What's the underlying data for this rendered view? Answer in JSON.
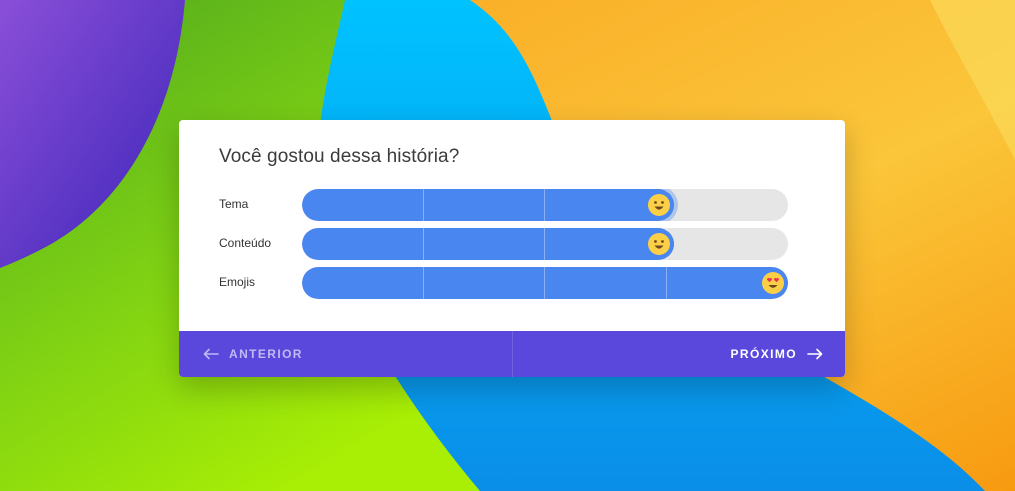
{
  "survey": {
    "question": "Você gostou dessa história?",
    "ratings": [
      {
        "label": "Tema",
        "value_fraction": 0.75,
        "emoji": "grinning-face-emoji",
        "focused": true
      },
      {
        "label": "Conteúdo",
        "value_fraction": 0.75,
        "emoji": "grinning-face-emoji",
        "focused": false
      },
      {
        "label": "Emojis",
        "value_fraction": 1.0,
        "emoji": "heart-eyes-face-emoji",
        "focused": false
      }
    ],
    "steps": 4
  },
  "footer": {
    "previous_label": "ANTERIOR",
    "next_label": "PRÓXIMO"
  },
  "colors": {
    "slider_fill": "#4a86f0",
    "slider_track": "#e6e6e6",
    "footer_bg": "#5a48dd",
    "emoji_face": "#fcd046"
  },
  "icons": {
    "previous": "arrow-left-icon",
    "next": "arrow-right-icon"
  }
}
